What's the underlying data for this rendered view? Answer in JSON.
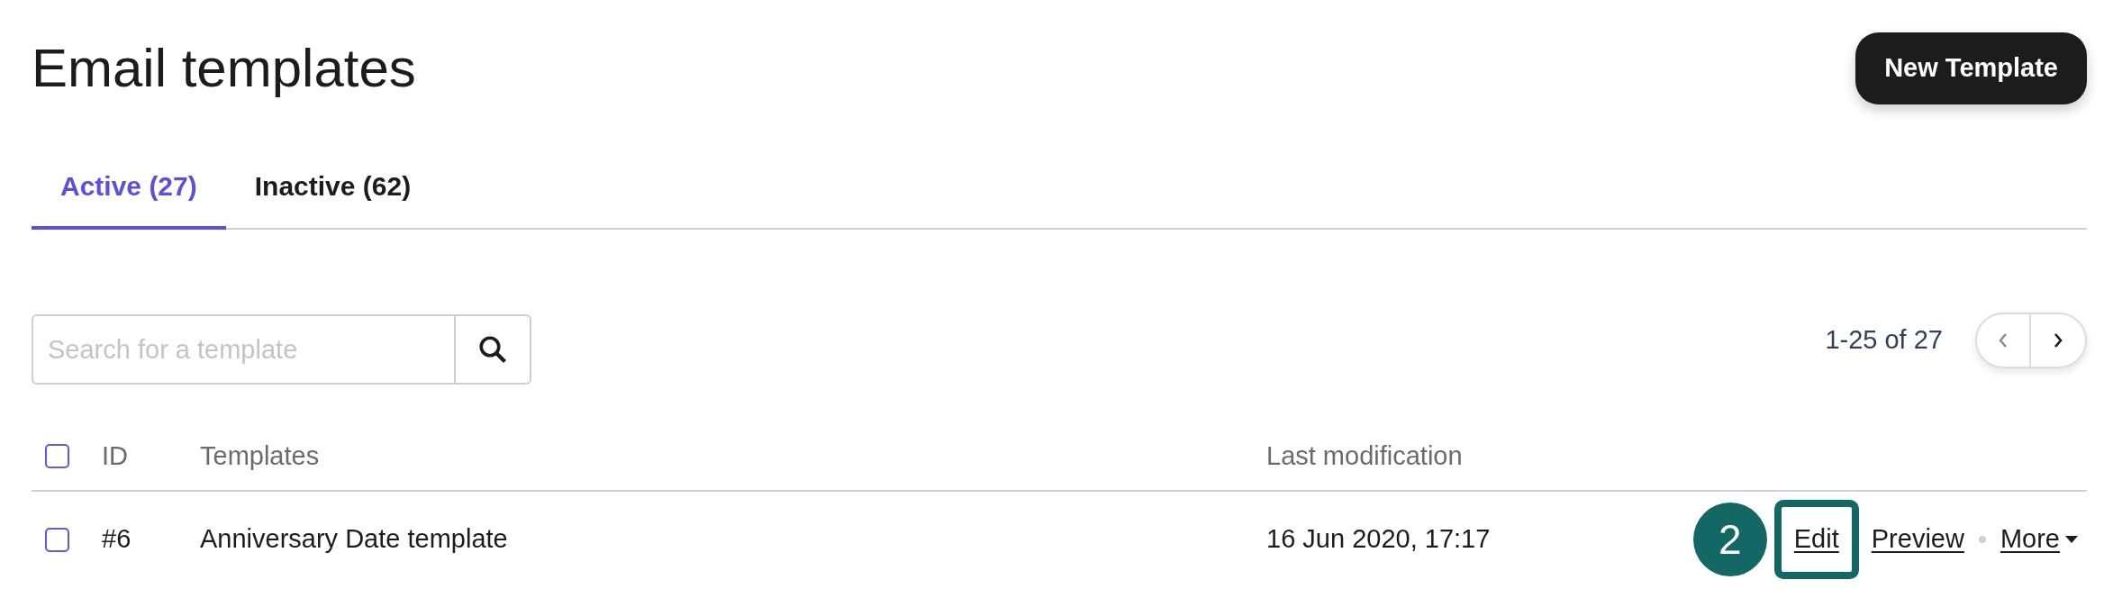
{
  "title": "Email templates",
  "new_button": "New Template",
  "tabs": [
    {
      "label": "Active (27)",
      "selected": true
    },
    {
      "label": "Inactive (62)",
      "selected": false
    }
  ],
  "search": {
    "placeholder": "Search for a template"
  },
  "pagination": {
    "range": "1-25 of 27",
    "prev_disabled": true,
    "next_disabled": false
  },
  "table": {
    "select_all_checked": false,
    "columns": [
      "ID",
      "Templates",
      "Last modification"
    ],
    "rows": [
      {
        "checked": false,
        "id": "#6",
        "name": "Anniversary Date template",
        "modified": "16 Jun 2020, 17:17",
        "callout": "2",
        "actions": [
          {
            "label": "Edit",
            "kind": "link",
            "highlighted": true,
            "separator_before": false
          },
          {
            "label": "Preview",
            "kind": "link",
            "highlighted": false,
            "separator_before": false
          },
          {
            "label": "More",
            "kind": "dropdown",
            "highlighted": false,
            "separator_before": true
          }
        ]
      }
    ]
  }
}
